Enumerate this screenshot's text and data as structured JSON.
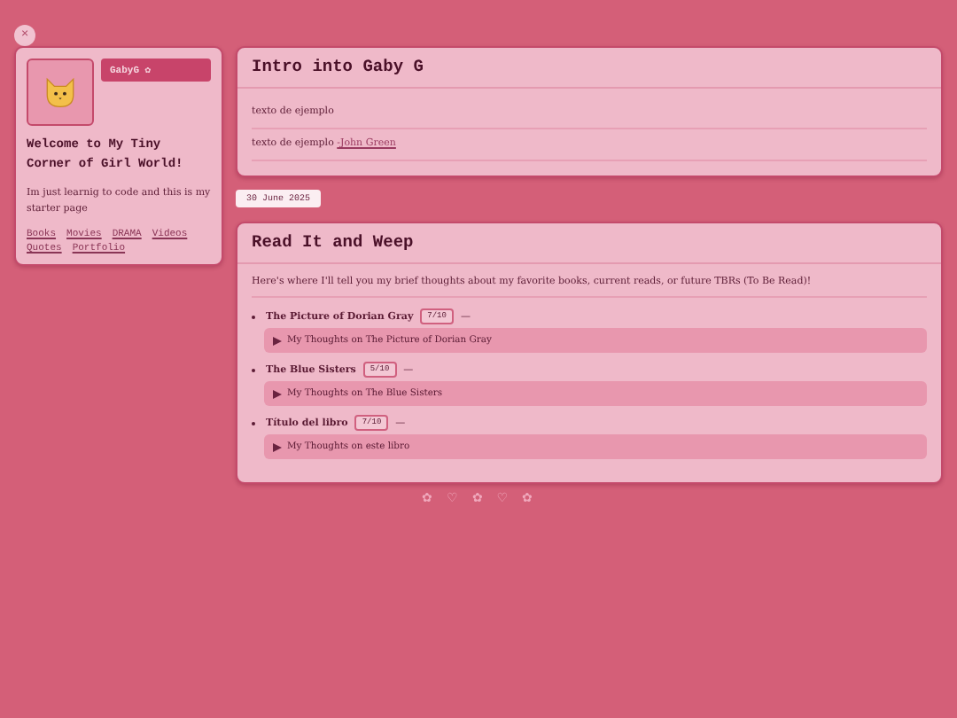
{
  "corner_button": {
    "label": "×"
  },
  "profile": {
    "name_badge": "GabyG ✿",
    "welcome": "Welcome to My Tiny Corner of Girl World!",
    "bio": "Im just learnig to code and this is my starter page",
    "links": [
      "Books",
      "Movies",
      "DRAMA",
      "Videos",
      "Quotes",
      "Portfolio"
    ]
  },
  "intro": {
    "title": "Intro into Gaby G",
    "lines": [
      {
        "text": "texto de ejemplo"
      },
      {
        "text": "texto de ejemplo",
        "link": "-John Green"
      }
    ]
  },
  "date": "30 June 2025",
  "reading": {
    "title": "Read It and Weep",
    "intro": "Here's where I'll tell you my brief thoughts about my favorite books, current reads, or future TBRs (To Be Read)!",
    "books": [
      {
        "title": "The Picture of Dorian Gray",
        "rating": "7/10",
        "dash": "—",
        "summary": "My Thoughts on The Picture of Dorian Gray",
        "expanded": false
      },
      {
        "title": "The Blue Sisters",
        "rating": "5/10",
        "dash": "—",
        "summary": "My Thoughts on The Blue Sisters",
        "expanded": false
      },
      {
        "title": "Título del libro",
        "rating": "7/10",
        "dash": "—",
        "summary": "My Thoughts on este libro",
        "expanded": false
      }
    ]
  },
  "footer": [
    "✿",
    "♡",
    "✿",
    "♡",
    "✿"
  ]
}
